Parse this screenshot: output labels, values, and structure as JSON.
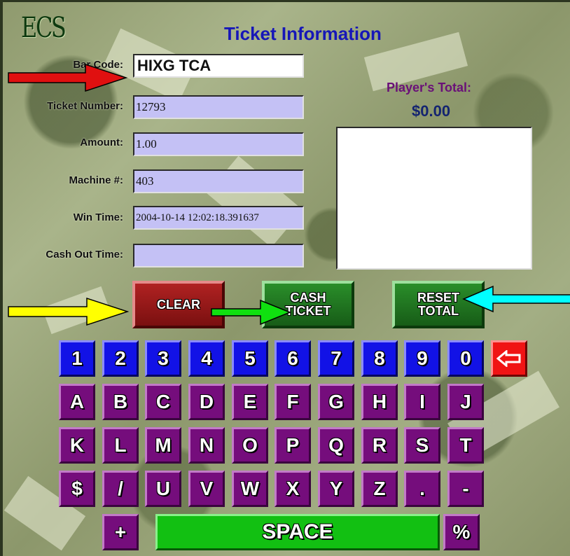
{
  "app": {
    "logo": "ECS",
    "title": "Ticket Information"
  },
  "form": {
    "bar_code": {
      "label": "Bar Code:",
      "value": "HIXG  TCA"
    },
    "ticket_number": {
      "label": "Ticket Number:",
      "value": "12793"
    },
    "amount": {
      "label": "Amount:",
      "value": "1.00"
    },
    "machine": {
      "label": "Machine #:",
      "value": "403"
    },
    "win_time": {
      "label": "Win Time:",
      "value": "2004-10-14 12:02:18.391637"
    },
    "cash_out_time": {
      "label": "Cash Out Time:",
      "value": ""
    }
  },
  "players_total": {
    "label": "Player's Total:",
    "value": "$0.00"
  },
  "buttons": {
    "clear": "CLEAR",
    "cash_ticket": "CASH\nTICKET",
    "reset_total": "RESET\nTOTAL"
  },
  "keypad": {
    "row1": [
      "1",
      "2",
      "3",
      "4",
      "5",
      "6",
      "7",
      "8",
      "9",
      "0"
    ],
    "backspace_icon": "left-arrow-icon",
    "row2": [
      "A",
      "B",
      "C",
      "D",
      "E",
      "F",
      "G",
      "H",
      "I",
      "J"
    ],
    "row3": [
      "K",
      "L",
      "M",
      "N",
      "O",
      "P",
      "Q",
      "R",
      "S",
      "T"
    ],
    "row4": [
      "$",
      "/",
      "U",
      "V",
      "W",
      "X",
      "Y",
      "Z",
      ".",
      "-"
    ],
    "plus": "+",
    "space": "SPACE",
    "percent": "%"
  },
  "colors": {
    "number_key": "#1212e6",
    "letter_key": "#750d7c",
    "backspace_key": "#f01414",
    "space_key": "#12c012",
    "arrow_red": "#e01010",
    "arrow_yellow": "#ffff00",
    "arrow_green": "#10e010",
    "arrow_cyan": "#00ffff"
  }
}
